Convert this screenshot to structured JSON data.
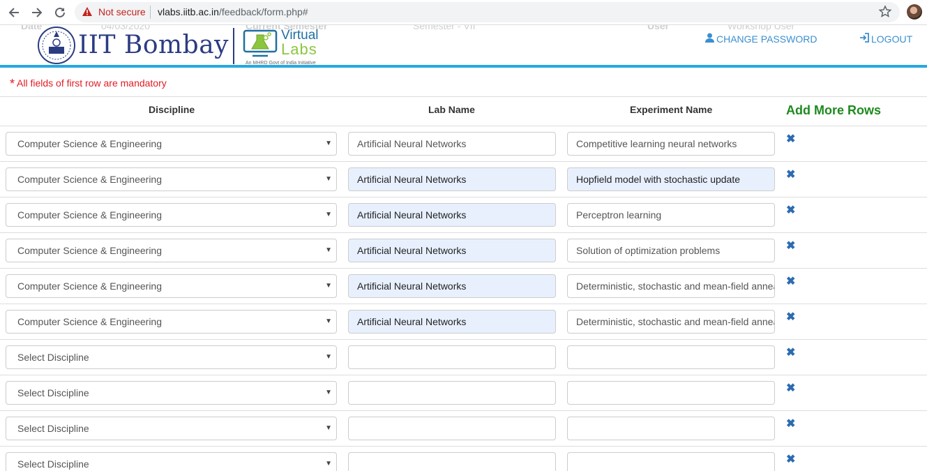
{
  "browser": {
    "security_label": "Not secure",
    "url_host": "vlabs.iitb.ac.in",
    "url_path": "/feedback/form.php#"
  },
  "ghost": {
    "date_label": "Date",
    "date_value": "04/03/2020",
    "semester_label": "Current Semester",
    "semester_value": "Semester - VII",
    "user_label": "User",
    "user_value": "Workshop User"
  },
  "header": {
    "institute": "IIT Bombay",
    "virtual": "Virtual",
    "labs": "Labs",
    "tagline": "An MHRD Govt of India Initiative",
    "change_password": "CHANGE PASSWORD",
    "logout": "LOGOUT",
    "accent_color": "#29a8e0"
  },
  "form": {
    "mandatory_note": "All fields of first row are mandatory",
    "col_discipline": "Discipline",
    "col_lab": "Lab Name",
    "col_experiment": "Experiment Name",
    "add_more_rows": "Add More Rows",
    "rows": [
      {
        "discipline": "Computer Science & Engineering",
        "lab": "Artificial Neural Networks",
        "experiment": "Competitive learning neural networks"
      },
      {
        "discipline": "Computer Science & Engineering",
        "lab": "Artificial Neural Networks",
        "experiment": "Hopfield model with stochastic update"
      },
      {
        "discipline": "Computer Science & Engineering",
        "lab": "Artificial Neural Networks",
        "experiment": "Perceptron learning"
      },
      {
        "discipline": "Computer Science & Engineering",
        "lab": "Artificial Neural Networks",
        "experiment": "Solution of optimization problems"
      },
      {
        "discipline": "Computer Science & Engineering",
        "lab": "Artificial Neural Networks",
        "experiment": "Deterministic, stochastic and mean-field annealing"
      },
      {
        "discipline": "Computer Science & Engineering",
        "lab": "Artificial Neural Networks",
        "experiment": "Deterministic, stochastic and mean-field annealing"
      },
      {
        "discipline": "Select Discipline",
        "lab": "",
        "experiment": ""
      },
      {
        "discipline": "Select Discipline",
        "lab": "",
        "experiment": ""
      },
      {
        "discipline": "Select Discipline",
        "lab": "",
        "experiment": ""
      },
      {
        "discipline": "Select Discipline",
        "lab": "",
        "experiment": ""
      }
    ]
  }
}
